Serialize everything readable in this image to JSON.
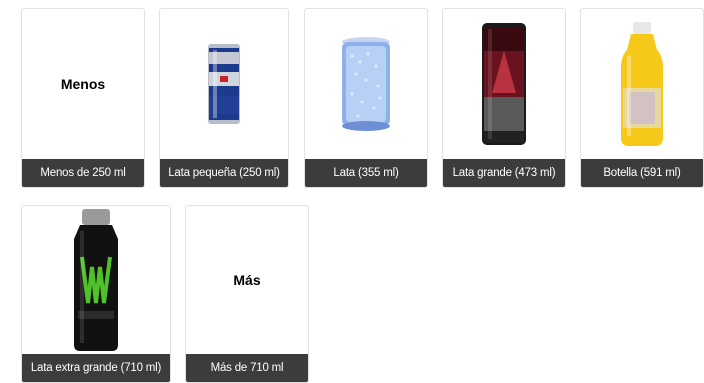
{
  "options": [
    {
      "label": "Menos de 250 ml",
      "placeholder_text": "Menos",
      "icon": "text-tile"
    },
    {
      "label": "Lata pequeña (250 ml)",
      "icon": "small-can-icon"
    },
    {
      "label": "Lata (355 ml)",
      "icon": "can-icon"
    },
    {
      "label": "Lata grande (473 ml)",
      "icon": "large-can-icon"
    },
    {
      "label": "Botella (591 ml)",
      "icon": "bottle-icon"
    },
    {
      "label": "Lata extra grande (710 ml)",
      "icon": "extra-large-can-icon"
    },
    {
      "label": "Más de 710 ml",
      "placeholder_text": "Más",
      "icon": "text-tile"
    }
  ],
  "colors": {
    "caption_bg": "#3c3c3c",
    "caption_text": "#ffffff",
    "card_border": "#e2e2e2"
  }
}
